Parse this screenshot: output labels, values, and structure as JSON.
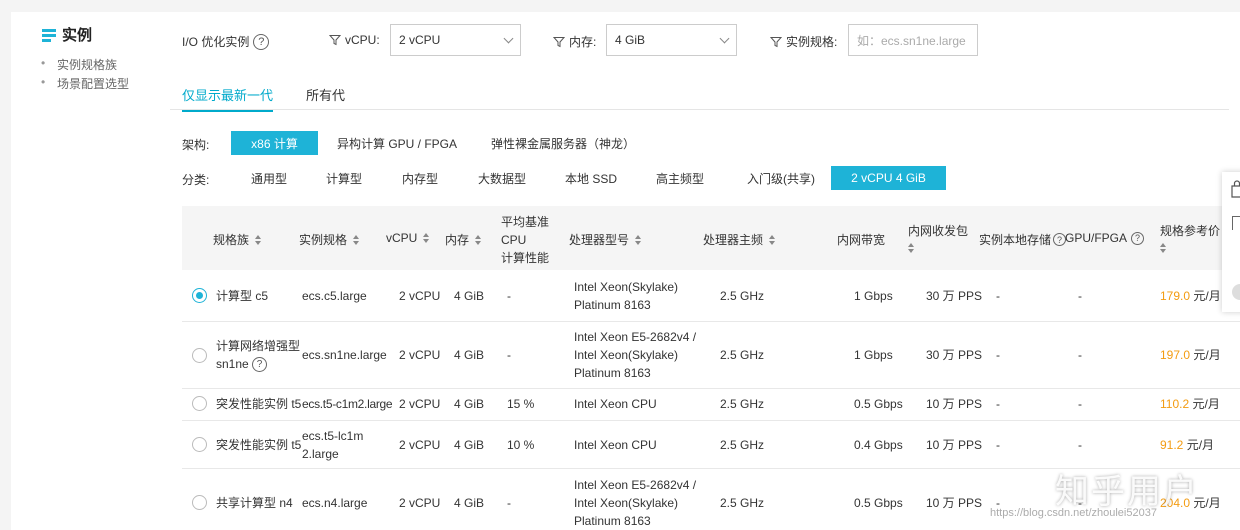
{
  "nav": {
    "title": "实例",
    "items": [
      "实例规格族",
      "场景配置选型"
    ]
  },
  "filters": {
    "io_label": "I/O 优化实例",
    "vcpu_label": "vCPU:",
    "vcpu_value": "2 vCPU",
    "mem_label": "内存:",
    "mem_value": "4 GiB",
    "spec_label": "实例规格:",
    "spec_placeholder": "如：ecs.sn1ne.large"
  },
  "tabs": [
    {
      "label": "仅显示最新一代",
      "active": true
    },
    {
      "label": "所有代",
      "active": false
    }
  ],
  "arch": {
    "label": "架构:",
    "options": [
      "x86 计算",
      "异构计算 GPU / FPGA",
      "弹性裸金属服务器（神龙）"
    ],
    "selected": 0
  },
  "category": {
    "label": "分类:",
    "options": [
      "通用型",
      "计算型",
      "内存型",
      "大数据型",
      "本地 SSD",
      "高主频型",
      "入门级(共享)",
      "2 vCPU 4 GiB"
    ],
    "selected": 7
  },
  "table": {
    "headers": {
      "family": "规格族",
      "spec": "实例规格",
      "vcpu": "vCPU",
      "mem": "内存",
      "baseline_1": "平均基准",
      "baseline_2": "CPU",
      "baseline_3": "计算性能",
      "cpu_model": "处理器型号",
      "freq": "处理器主频",
      "bandwidth": "内网带宽",
      "pps": "内网收发包",
      "local_storage": "实例本地存储",
      "gpu": "GPU/FPGA",
      "price": "规格参考价"
    },
    "rows": [
      {
        "family": "计算型 c5",
        "spec": "ecs.c5.large",
        "vcpu": "2 vCPU",
        "mem": "4 GiB",
        "baseline": "-",
        "cpu": [
          "Intel Xeon(Skylake)",
          "Platinum 8163"
        ],
        "freq": "2.5 GHz",
        "bw": "1 Gbps",
        "pps": "30 万 PPS",
        "local": "-",
        "gpu": "-",
        "price": "179.0",
        "unit": "元/月",
        "checked": true
      },
      {
        "family": "计算网络增强型 sn1ne",
        "spec": "ecs.sn1ne.large",
        "vcpu": "2 vCPU",
        "mem": "4 GiB",
        "baseline": "-",
        "cpu": [
          "Intel Xeon E5-2682v4 /",
          "Intel Xeon(Skylake)",
          "Platinum 8163"
        ],
        "freq": "2.5 GHz",
        "bw": "1 Gbps",
        "pps": "30 万 PPS",
        "local": "-",
        "gpu": "-",
        "price": "197.0",
        "unit": "元/月",
        "checked": false
      },
      {
        "family": "突发性能实例 t5",
        "spec": "ecs.t5-c1m2.large",
        "vcpu": "2 vCPU",
        "mem": "4 GiB",
        "baseline": "15 %",
        "cpu": [
          "Intel Xeon CPU"
        ],
        "freq": "2.5 GHz",
        "bw": "0.5 Gbps",
        "pps": "10 万 PPS",
        "local": "-",
        "gpu": "-",
        "price": "110.2",
        "unit": "元/月",
        "checked": false
      },
      {
        "family": "突发性能实例 t5",
        "spec": "ecs.t5-lc1m2.large",
        "vcpu": "2 vCPU",
        "mem": "4 GiB",
        "baseline": "10 %",
        "cpu": [
          "Intel Xeon CPU"
        ],
        "freq": "2.5 GHz",
        "bw": "0.4 Gbps",
        "pps": "10 万 PPS",
        "local": "-",
        "gpu": "-",
        "price": "91.2",
        "unit": "元/月",
        "checked": false
      },
      {
        "family": "共享计算型 n4",
        "spec": "ecs.n4.large",
        "vcpu": "2 vCPU",
        "mem": "4 GiB",
        "baseline": "-",
        "cpu": [
          "Intel Xeon E5-2682v4 /",
          "Intel Xeon(Skylake)",
          "Platinum 8163"
        ],
        "freq": "2.5 GHz",
        "bw": "0.5 Gbps",
        "pps": "10 万 PPS",
        "local": "-",
        "gpu": "-",
        "price": "204.0",
        "unit": "元/月",
        "checked": false
      }
    ]
  },
  "watermark": {
    "text": "知乎用户",
    "url": "https://blog.csdn.net/zhoulei52037"
  },
  "colors": {
    "accent": "#1eb3d7",
    "price": "#f39c12"
  }
}
